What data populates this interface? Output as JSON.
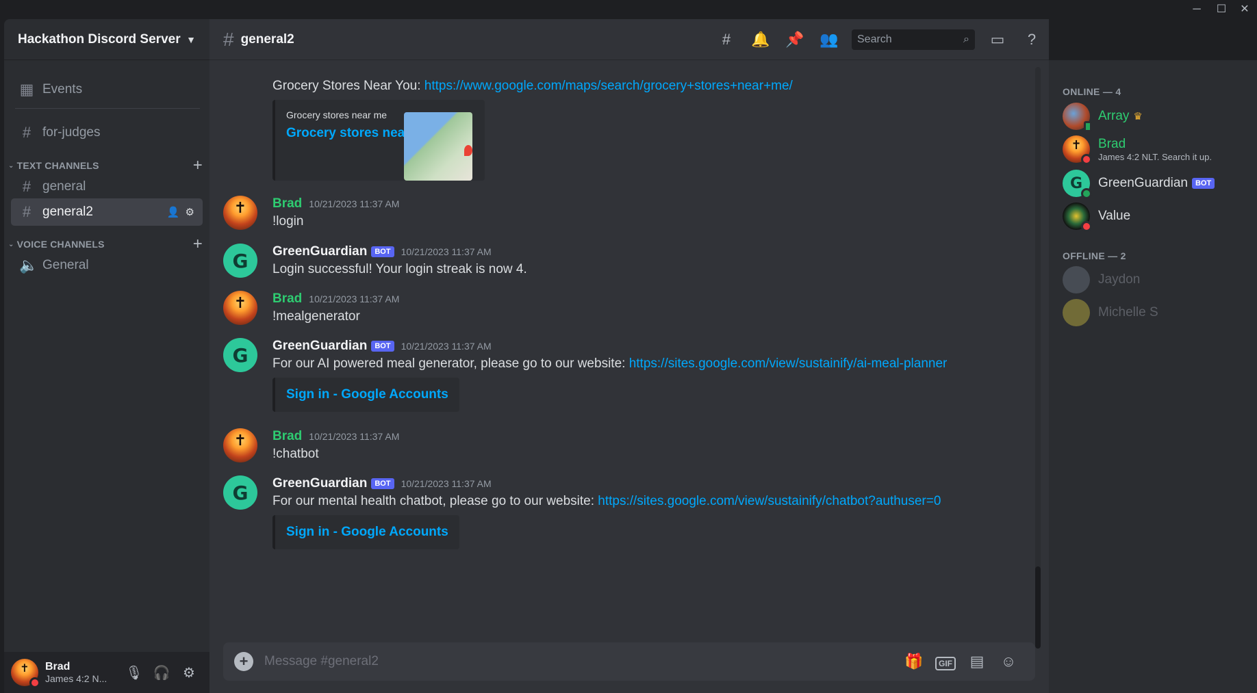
{
  "window": {
    "minimize": "─",
    "maximize": "☐",
    "close": "✕"
  },
  "server": {
    "name": "Hackathon Discord Server"
  },
  "sidebar": {
    "events_label": "Events",
    "top_channel": "for-judges",
    "text_category": "TEXT CHANNELS",
    "text_channels": [
      "general",
      "general2"
    ],
    "voice_category": "VOICE CHANNELS",
    "voice_channels": [
      "General"
    ]
  },
  "user": {
    "name": "Brad",
    "status": "James 4:2 N..."
  },
  "channel": {
    "name": "general2",
    "search_placeholder": "Search",
    "composer_placeholder": "Message #general2"
  },
  "messages": {
    "m0": {
      "text_prefix": "Grocery Stores Near You: ",
      "link": "https://www.google.com/maps/search/grocery+stores+near+me/",
      "embed_provider": "Grocery stores near me",
      "embed_title": "Grocery stores near me"
    },
    "m1": {
      "author": "Brad",
      "time": "10/21/2023 11:37 AM",
      "text": "!login"
    },
    "m2": {
      "author": "GreenGuardian",
      "badge": "BOT",
      "time": "10/21/2023 11:37 AM",
      "text": "Login successful! Your login streak is now 4."
    },
    "m3": {
      "author": "Brad",
      "time": "10/21/2023 11:37 AM",
      "text": "!mealgenerator"
    },
    "m4": {
      "author": "GreenGuardian",
      "badge": "BOT",
      "time": "10/21/2023 11:37 AM",
      "text": "For our AI powered meal generator, please go to our website: ",
      "link": "https://sites.google.com/view/sustainify/ai-meal-planner",
      "embed_title": "Sign in - Google Accounts"
    },
    "m5": {
      "author": "Brad",
      "time": "10/21/2023 11:37 AM",
      "text": "!chatbot"
    },
    "m6": {
      "author": "GreenGuardian",
      "badge": "BOT",
      "time": "10/21/2023 11:37 AM",
      "text": "For our mental health chatbot, please go to our website: ",
      "link": "https://sites.google.com/view/sustainify/chatbot?authuser=0",
      "embed_title": "Sign in - Google Accounts"
    }
  },
  "members": {
    "online_header": "ONLINE — 4",
    "offline_header": "OFFLINE — 2",
    "array": "Array",
    "brad": "Brad",
    "brad_status": "James 4:2 NLT. Search it up.",
    "gg": "GreenGuardian",
    "gg_badge": "BOT",
    "value": "Value",
    "jaydon": "Jaydon",
    "michelle": "Michelle S"
  },
  "colors": {
    "accent_link": "#00a8fc",
    "brand": "#5865f2",
    "brad_role": "#2ecc71",
    "dnd": "#f23f43",
    "online": "#23a55a"
  }
}
